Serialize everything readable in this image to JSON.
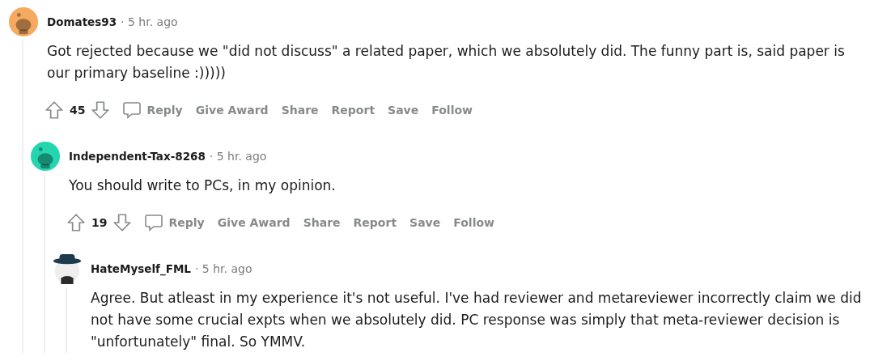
{
  "comments": [
    {
      "author": "Domates93",
      "time": "· 5 hr. ago",
      "avatar": {
        "kind": "snoo",
        "color": "#f6a960"
      },
      "body": "Got rejected because we \"did not discuss\" a related paper, which we absolutely did. The funny part is, said paper is our primary baseline :)))))",
      "votes": "45",
      "actions": [
        {
          "kind": "reply",
          "label": "Reply"
        },
        {
          "kind": "text",
          "label": "Give Award"
        },
        {
          "kind": "text",
          "label": "Share"
        },
        {
          "kind": "text",
          "label": "Report"
        },
        {
          "kind": "text",
          "label": "Save"
        },
        {
          "kind": "text",
          "label": "Follow"
        }
      ],
      "children": [
        {
          "author": "Independent-Tax-8268",
          "time": "· 5 hr. ago",
          "avatar": {
            "kind": "snoo",
            "color": "#24d6b0"
          },
          "body": "You should write to PCs, in my opinion.",
          "votes": "19",
          "actions": [
            {
              "kind": "reply",
              "label": "Reply"
            },
            {
              "kind": "text",
              "label": "Give Award"
            },
            {
              "kind": "text",
              "label": "Share"
            },
            {
              "kind": "text",
              "label": "Report"
            },
            {
              "kind": "text",
              "label": "Save"
            },
            {
              "kind": "text",
              "label": "Follow"
            }
          ],
          "children": [
            {
              "author": "HateMyself_FML",
              "time": "· 5 hr. ago",
              "avatar": {
                "kind": "hat",
                "color": "#1d3b4f"
              },
              "body": "Agree. But atleast in my experience it's not useful. I've had reviewer and metareviewer incorrectly claim we did not have some crucial expts when we absolutely did. PC response was simply that meta-reviewer decision is \"unfortunately\" final. So YMMV."
            }
          ]
        }
      ]
    }
  ]
}
